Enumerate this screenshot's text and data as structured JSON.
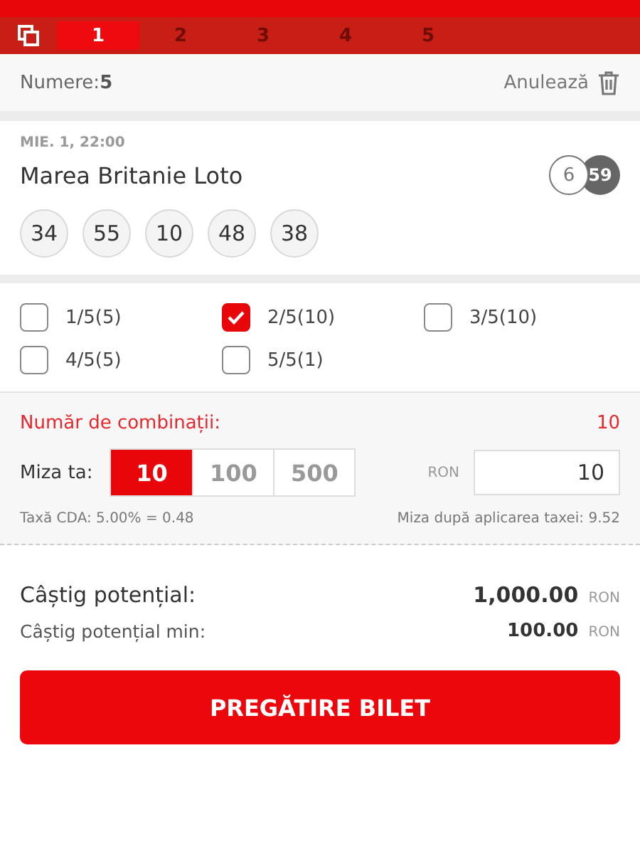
{
  "tabs": [
    {
      "label": "1",
      "selected": true
    },
    {
      "label": "2",
      "selected": false
    },
    {
      "label": "3",
      "selected": false
    },
    {
      "label": "4",
      "selected": false
    },
    {
      "label": "5",
      "selected": false
    }
  ],
  "header": {
    "numbers_label": "Numere:",
    "numbers_count": "5",
    "cancel": "Anulează"
  },
  "event": {
    "date": "MIE. 1, 22:00",
    "name": "Marea Britanie Loto",
    "draw_count": "6",
    "pool_size": "59",
    "numbers": [
      "34",
      "55",
      "10",
      "48",
      "38"
    ]
  },
  "systems": [
    {
      "label": "1/5(5)",
      "checked": false
    },
    {
      "label": "2/5(10)",
      "checked": true
    },
    {
      "label": "3/5(10)",
      "checked": false
    },
    {
      "label": "4/5(5)",
      "checked": false
    },
    {
      "label": "5/5(1)",
      "checked": false
    }
  ],
  "stake": {
    "combinations_label": "Număr de combinații:",
    "combinations": "10",
    "stake_label": "Miza ta:",
    "presets": [
      {
        "label": "10",
        "selected": true
      },
      {
        "label": "100",
        "selected": false
      },
      {
        "label": "500",
        "selected": false
      }
    ],
    "currency": "RON",
    "value": "10",
    "tax": "Taxă CDA: 5.00% = 0.48",
    "after_tax": "Miza după aplicarea taxei: 9.52"
  },
  "winnings": [
    {
      "label": "Câștig potențial:",
      "amount": "1,000.00",
      "currency": "RON",
      "kind": "main"
    },
    {
      "label": "Câștig potențial min:",
      "amount": "100.00",
      "currency": "RON",
      "kind": "min"
    }
  ],
  "button": "PREGĂTIRE BILET"
}
